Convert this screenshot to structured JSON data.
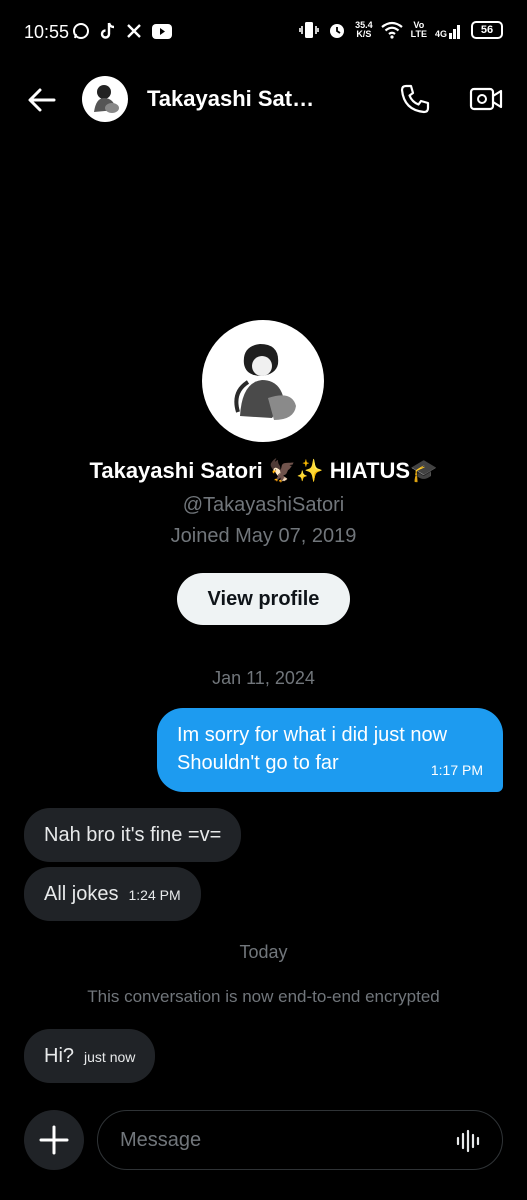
{
  "status_bar": {
    "time": "10:55",
    "speed_value": "35.4",
    "speed_unit": "K/S",
    "net_top": "Vo",
    "net_bottom": "LTE",
    "signal_label": "4G",
    "battery": "56",
    "icons": [
      "whatsapp-icon",
      "tiktok-icon",
      "x-icon",
      "youtube-icon",
      "vibrate-icon",
      "alarm-icon",
      "wifi-icon",
      "signal-icon"
    ]
  },
  "header": {
    "title": "Takayashi Sat…",
    "icons": [
      "back-arrow-icon",
      "phone-icon",
      "video-call-icon"
    ]
  },
  "profile": {
    "name": "Takayashi Satori 🦅✨ HIATUS🎓",
    "handle": "@TakayashiSatori",
    "joined": "Joined May 07, 2019",
    "view_profile_label": "View profile"
  },
  "conversation": {
    "date1": "Jan 11, 2024",
    "outgoing": {
      "line1": "Im sorry for what i did just now",
      "line2": "Shouldn't go to far",
      "time": "1:17 PM"
    },
    "incoming1": {
      "text": "Nah bro it's fine =v="
    },
    "incoming2": {
      "text": "All jokes",
      "time": "1:24 PM"
    },
    "date2": "Today",
    "encryption_note": "This conversation is now end-to-end encrypted",
    "incoming3": {
      "text": "Hi?",
      "time": "just now"
    }
  },
  "composer": {
    "placeholder": "Message",
    "icons": [
      "plus-icon",
      "audio-wave-icon"
    ]
  },
  "colors": {
    "background": "#000000",
    "outgoing_bubble": "#1d9bf0",
    "incoming_bubble": "#202327",
    "muted_text": "#71767b",
    "button_bg": "#eff3f4"
  }
}
